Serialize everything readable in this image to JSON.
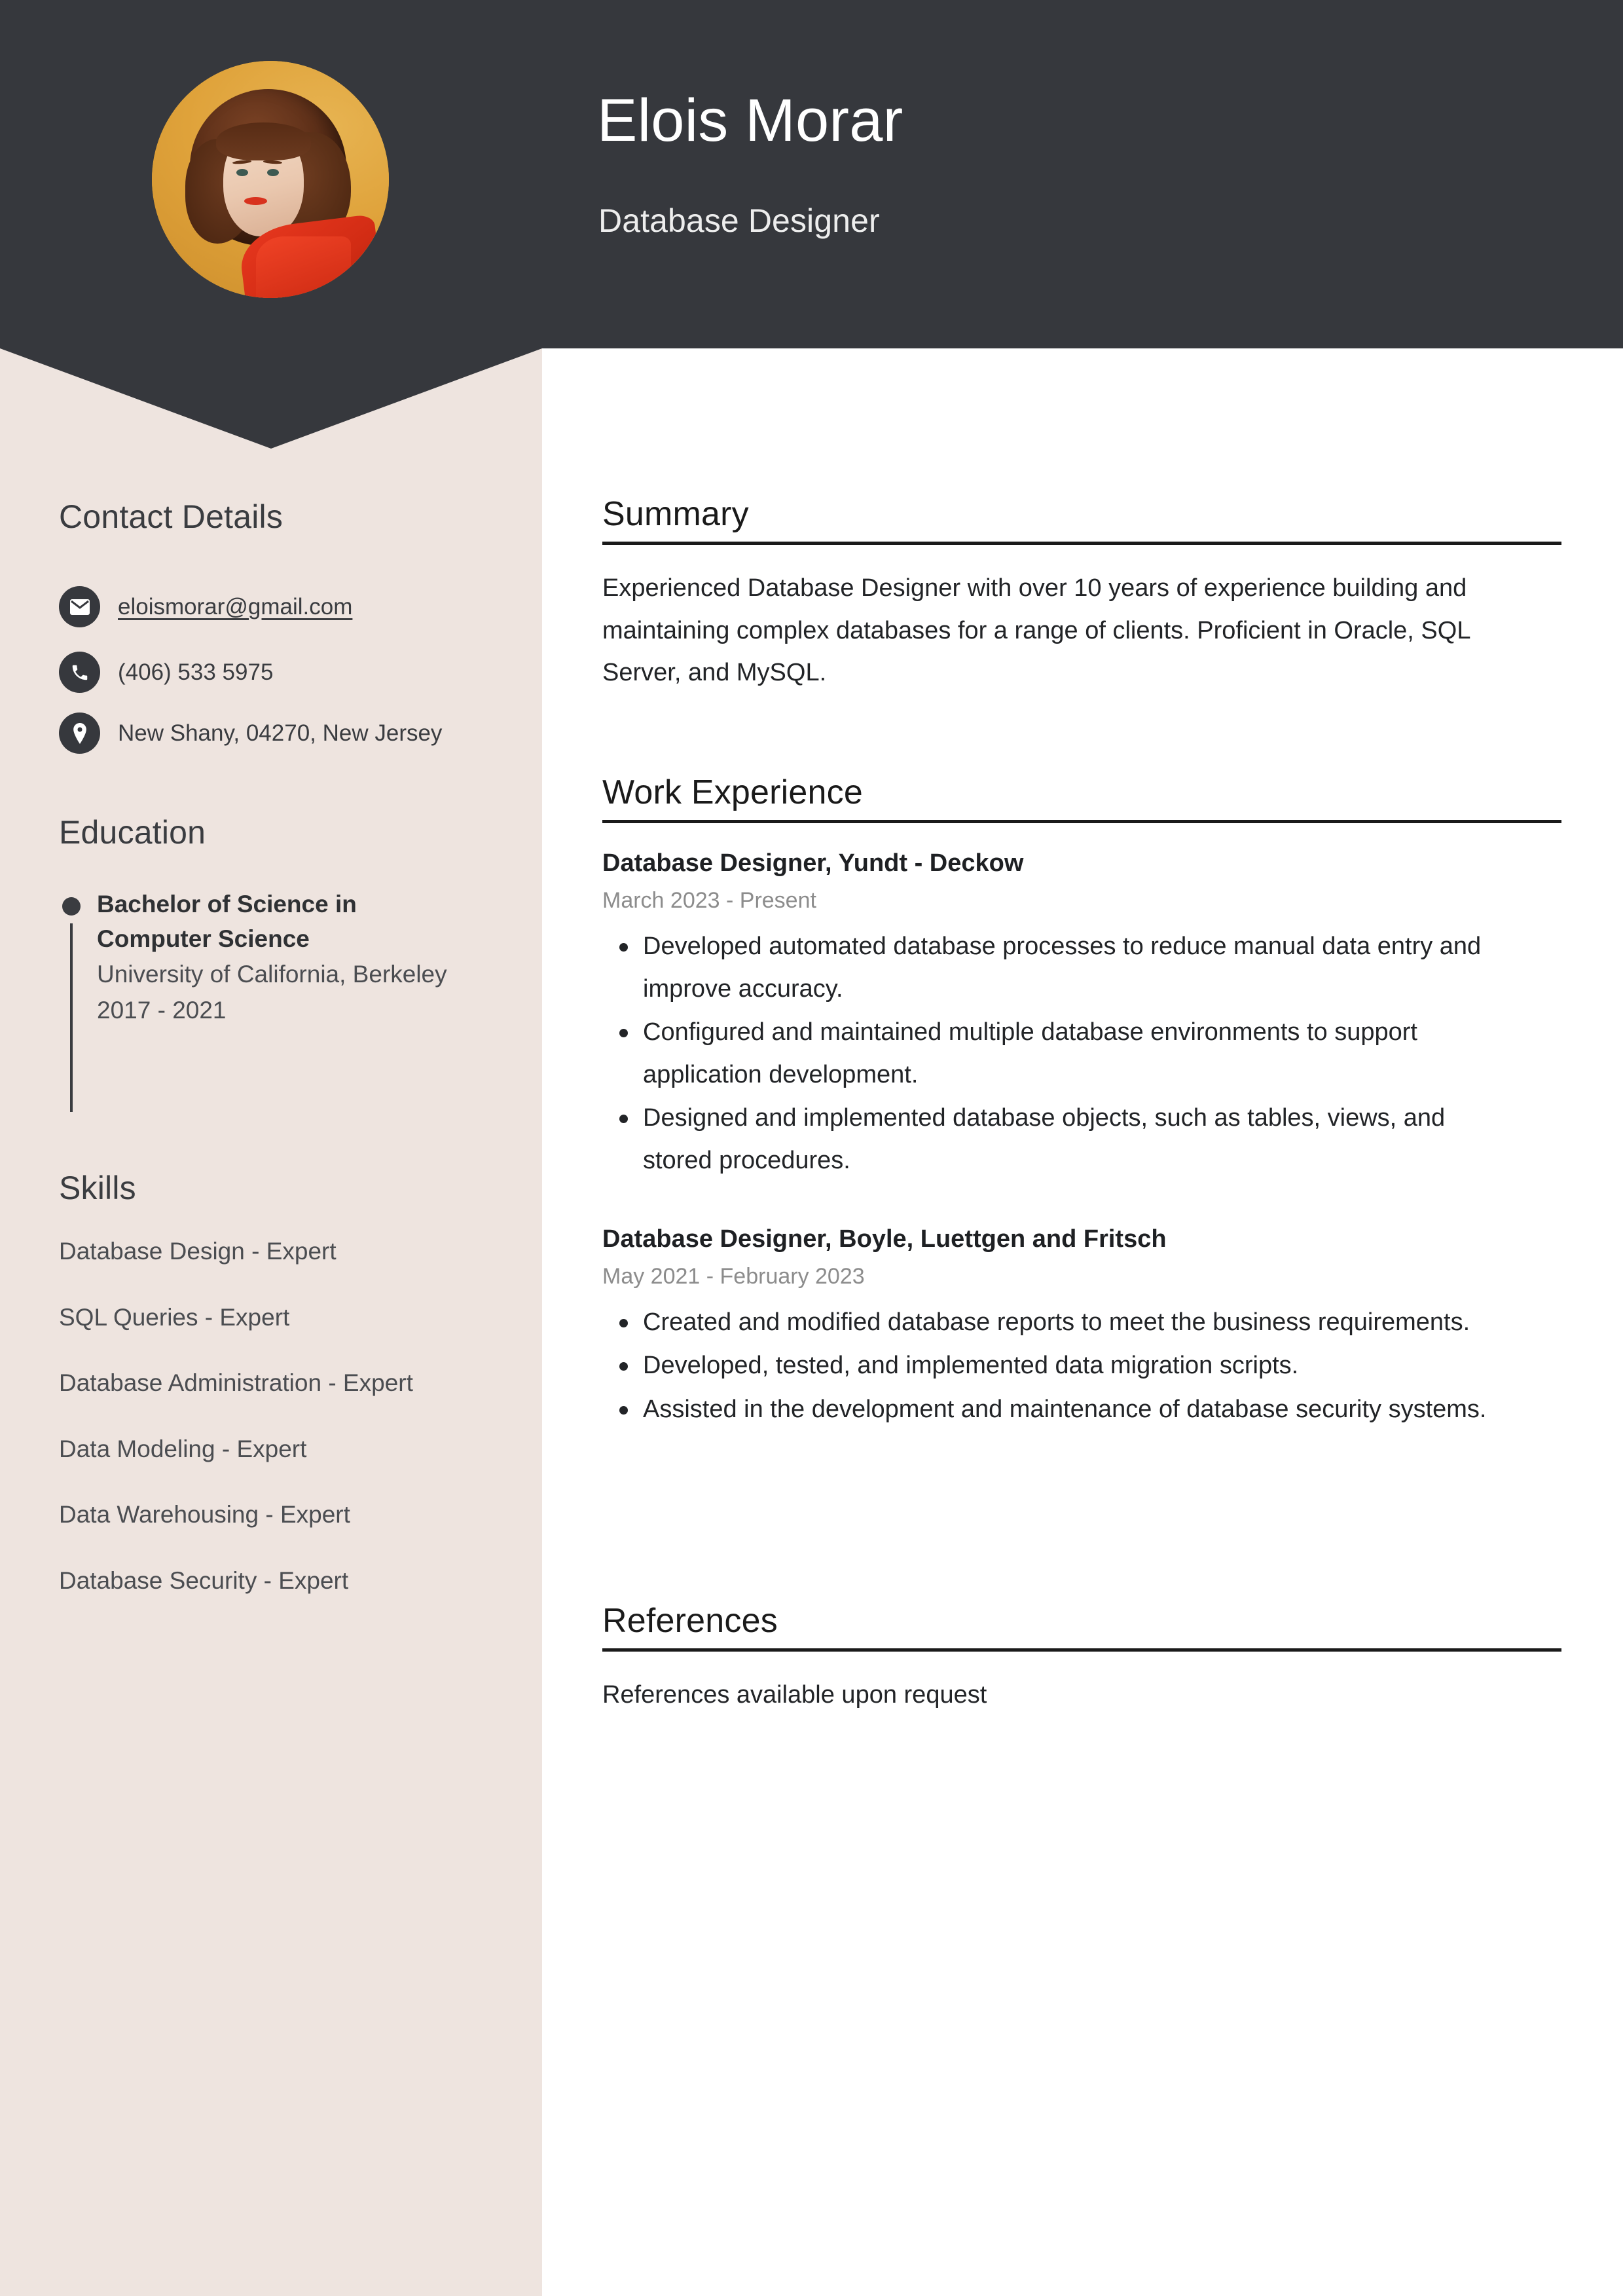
{
  "header": {
    "name": "Elois Morar",
    "job_title": "Database Designer",
    "avatar_alt": "profile-photo"
  },
  "sidebar": {
    "contact": {
      "heading": "Contact Details",
      "items": [
        {
          "icon": "envelope-icon",
          "value": "eloismorar@gmail.com",
          "is_link": true
        },
        {
          "icon": "phone-icon",
          "value": "(406) 533 5975",
          "is_link": false
        },
        {
          "icon": "location-pin-icon",
          "value": "New Shany, 04270, New Jersey",
          "is_link": false
        }
      ]
    },
    "education": {
      "heading": "Education",
      "items": [
        {
          "degree": "Bachelor of Science in Computer Science",
          "school": "University of California, Berkeley",
          "dates": "2017 - 2021"
        }
      ]
    },
    "skills": {
      "heading": "Skills",
      "items": [
        "Database Design - Expert",
        "SQL Queries - Expert",
        "Database Administration - Expert",
        "Data Modeling - Expert",
        "Data Warehousing - Expert",
        "Database Security - Expert"
      ]
    }
  },
  "main": {
    "summary": {
      "heading": "Summary",
      "text": "Experienced Database Designer with over 10 years of experience building and maintaining complex databases for a range of clients. Proficient in Oracle, SQL Server, and MySQL."
    },
    "work_experience": {
      "heading": "Work Experience",
      "jobs": [
        {
          "title": "Database Designer, Yundt - Deckow",
          "dates": "March 2023 - Present",
          "bullets": [
            "Developed automated database processes to reduce manual data entry and improve accuracy.",
            "Configured and maintained multiple database environments to support application development.",
            "Designed and implemented database objects, such as tables, views, and stored procedures."
          ]
        },
        {
          "title": "Database Designer, Boyle, Luettgen and Fritsch",
          "dates": "May 2021 - February 2023",
          "bullets": [
            "Created and modified database reports to meet the business requirements.",
            "Developed, tested, and implemented data migration scripts.",
            "Assisted in the development and maintenance of database security systems."
          ]
        }
      ]
    },
    "references": {
      "heading": "References",
      "text": "References available upon request"
    }
  },
  "colors": {
    "header_bg": "#36383D",
    "sidebar_bg": "#EEE4DF",
    "main_bg": "#FFFFFF",
    "accent_dark": "#3A3C40",
    "muted_text": "#8C8C8C",
    "avatar_bg": "#DFA23A"
  }
}
